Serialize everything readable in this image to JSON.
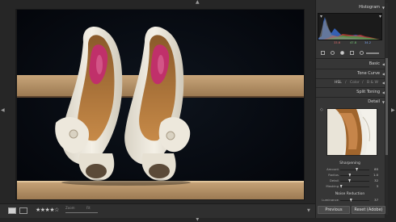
{
  "histogram": {
    "title": "Histogram",
    "readouts": [
      "33.6",
      "47.8",
      "34.2"
    ]
  },
  "panels": {
    "basic": "Basic",
    "tone_curve": "Tone Curve",
    "hsl": [
      "HSL",
      "/",
      "Color",
      "/",
      "B & W"
    ],
    "split_toning": "Split Toning",
    "detail": "Detail"
  },
  "sharpening": {
    "title": "Sharpening",
    "rows": [
      {
        "label": "Amount",
        "value": "85",
        "pos": 0.57
      },
      {
        "label": "Radius",
        "value": "1.0",
        "pos": 0.33
      },
      {
        "label": "Detail",
        "value": "32",
        "pos": 0.32
      },
      {
        "label": "Masking",
        "value": "3",
        "pos": 0.03
      }
    ]
  },
  "noise_reduction": {
    "title": "Noise Reduction",
    "rows": [
      {
        "label": "Luminance",
        "value": "37",
        "pos": 0.37
      }
    ]
  },
  "toolbar": {
    "rating": "★★★★☆",
    "zoom_label": "Zoom",
    "zoom_value": "Fit"
  },
  "buttons": {
    "previous": "Previous",
    "reset": "Reset (Adobe)"
  },
  "colors": {
    "panel_bg": "#363636",
    "app_bg": "#262626",
    "insole_pink": "#c0306a"
  }
}
